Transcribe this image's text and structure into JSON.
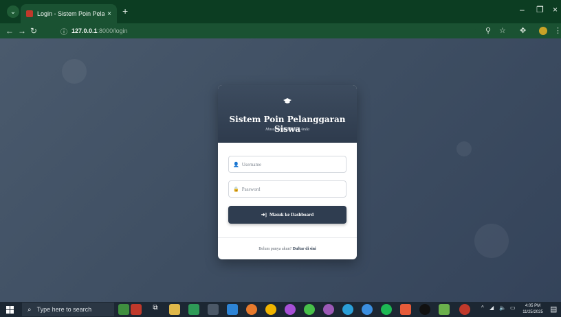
{
  "browser": {
    "tab_title": "Login - Sistem Poin Pelanggara",
    "tab_close": "×",
    "new_tab": "+",
    "url_host": "127.0.0.1",
    "url_path": ":8000/login",
    "window": {
      "minimize": "–",
      "restore": "❐",
      "close": "×"
    }
  },
  "login": {
    "icon": "graduation-cap-icon",
    "title": "Sistem Poin Pelanggaran Siswa",
    "subtitle": "Masuk ke dashboard Anda",
    "username_placeholder": "Username",
    "password_placeholder": "Password",
    "submit_label": "Masuk ke Dashboard",
    "footer_text": "Belum punya akun?",
    "footer_link": "Daftar di sini"
  },
  "taskbar": {
    "search_placeholder": "Type here to search",
    "clock_time": "4:05 PM",
    "clock_date": "11/25/2025"
  },
  "colors": {
    "brand_dark": "#2f3d50",
    "page_bg": "#3e4e62",
    "browser_chrome": "#1a5232"
  }
}
